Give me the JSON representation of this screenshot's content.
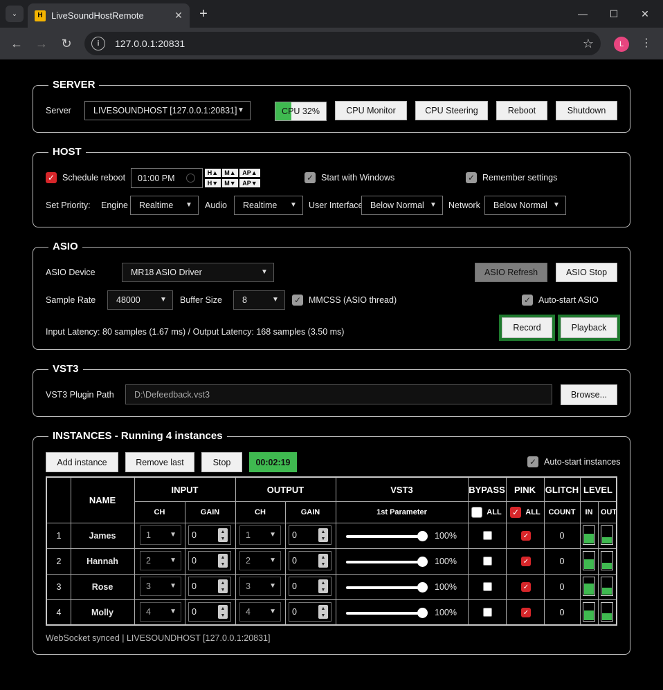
{
  "browser": {
    "tab_title": "LiveSoundHostRemote",
    "favicon_text": "H",
    "url": "127.0.0.1:20831",
    "avatar_letter": "L"
  },
  "server": {
    "legend": "SERVER",
    "server_label": "Server",
    "server_value": "LIVESOUNDHOST [127.0.0.1:20831]",
    "cpu_label": "CPU 32%",
    "cpu_percent": 32,
    "buttons": {
      "cpu_monitor": "CPU Monitor",
      "cpu_steering": "CPU Steering",
      "reboot": "Reboot",
      "shutdown": "Shutdown"
    }
  },
  "host": {
    "legend": "HOST",
    "schedule_reboot_label": "Schedule reboot",
    "schedule_reboot_checked": true,
    "reboot_time": "01:00  PM",
    "spin": {
      "h_up": "H▲",
      "h_down": "H▼",
      "m_up": "M▲",
      "m_down": "M▼",
      "ap_up": "AP▲",
      "ap_down": "AP▼"
    },
    "start_with_windows_label": "Start with Windows",
    "start_with_windows_checked": true,
    "remember_settings_label": "Remember settings",
    "remember_settings_checked": true,
    "set_priority_label": "Set Priority:",
    "engine_label": "Engine",
    "engine_value": "Realtime",
    "audio_label": "Audio",
    "audio_value": "Realtime",
    "ui_label": "User Interface",
    "ui_value": "Below Normal",
    "network_label": "Network",
    "network_value": "Below Normal"
  },
  "asio": {
    "legend": "ASIO",
    "device_label": "ASIO Device",
    "device_value": "MR18 ASIO Driver",
    "refresh_label": "ASIO Refresh",
    "stop_label": "ASIO Stop",
    "sample_rate_label": "Sample Rate",
    "sample_rate_value": "48000",
    "buffer_size_label": "Buffer Size",
    "buffer_size_value": "8",
    "mmcss_label": "MMCSS (ASIO thread)",
    "mmcss_checked": true,
    "autostart_label": "Auto-start ASIO",
    "autostart_checked": true,
    "latency_text": "Input Latency: 80 samples (1.67 ms) / Output Latency: 168 samples (3.50 ms)",
    "record_label": "Record",
    "playback_label": "Playback"
  },
  "vst3": {
    "legend": "VST3",
    "path_label": "VST3 Plugin Path",
    "path_value": "D:\\Defeedback.vst3",
    "browse_label": "Browse..."
  },
  "instances": {
    "legend": "INSTANCES - Running 4 instances",
    "add_label": "Add instance",
    "remove_label": "Remove last",
    "stop_label": "Stop",
    "timer": "00:02:19",
    "autostart_label": "Auto-start instances",
    "autostart_checked": true,
    "headers": {
      "name": "NAME",
      "input": "INPUT",
      "output": "OUTPUT",
      "vst3": "VST3",
      "bypass": "BYPASS",
      "pink": "PINK",
      "glitch": "GLITCH",
      "level": "LEVEL",
      "ch": "CH",
      "gain": "GAIN",
      "first_param": "1st Parameter",
      "all": "ALL",
      "count": "COUNT",
      "in": "IN",
      "out": "OUT"
    },
    "bypass_all_checked": false,
    "pink_all_checked": true,
    "rows": [
      {
        "index": "1",
        "name": "James",
        "in_ch": "1",
        "in_gain": "0",
        "out_ch": "1",
        "out_gain": "0",
        "param": "100%",
        "param_value": 1.0,
        "bypass": false,
        "pink": true,
        "glitch": "0",
        "level_in": 0.55,
        "level_out": 0.35
      },
      {
        "index": "2",
        "name": "Hannah",
        "in_ch": "2",
        "in_gain": "0",
        "out_ch": "2",
        "out_gain": "0",
        "param": "100%",
        "param_value": 1.0,
        "bypass": false,
        "pink": true,
        "glitch": "0",
        "level_in": 0.55,
        "level_out": 0.35
      },
      {
        "index": "3",
        "name": "Rose",
        "in_ch": "3",
        "in_gain": "0",
        "out_ch": "3",
        "out_gain": "0",
        "param": "100%",
        "param_value": 1.0,
        "bypass": false,
        "pink": true,
        "glitch": "0",
        "level_in": 0.6,
        "level_out": 0.4
      },
      {
        "index": "4",
        "name": "Molly",
        "in_ch": "4",
        "in_gain": "0",
        "out_ch": "4",
        "out_gain": "0",
        "param": "100%",
        "param_value": 1.0,
        "bypass": false,
        "pink": true,
        "glitch": "0",
        "level_in": 0.55,
        "level_out": 0.4
      }
    ],
    "status_text": "WebSocket synced  |  LIVESOUNDHOST [127.0.0.1:20831]"
  },
  "colors": {
    "accent_green": "#3fb950",
    "check_red": "#d7262a",
    "record_border": "#1f7a2e"
  }
}
